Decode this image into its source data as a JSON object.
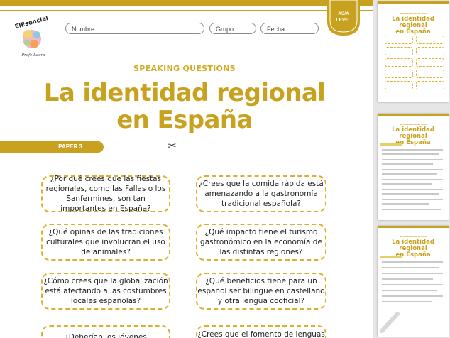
{
  "header": {
    "logo_text": "ElEsencial",
    "logo_sub": "Profe Laura",
    "fields": [
      {
        "label": "Nombre:"
      },
      {
        "label": "Grupo:"
      },
      {
        "label": "Fecha:"
      }
    ],
    "level_badge": {
      "line1": "AS/A",
      "line2": "LEVEL"
    }
  },
  "kicker": "SPEAKING QUESTIONS",
  "title": {
    "line1": "La identidad regional",
    "line2": "en España"
  },
  "paper_label": "PAPER 3",
  "cards": [
    "¿Por qué crees que las fiestas regionales, como las Fallas o los Sanfermines, son tan importantes en España?",
    "¿Crees que la comida rápida está amenazando a la gastronomía tradicional española?",
    "¿Qué opinas de las tradiciones culturales que involucran el uso de animales?",
    "¿Qué impacto tiene el turismo gastronómico en la economía de las distintas regiones?",
    "¿Cómo crees que la globalización está afectando a las costumbres locales españolas?",
    "¿Qué beneficios tiene para un español ser bilingüe en castellano y otra lengua cooficial?",
    "¿Deberían los jóvenes",
    "¿Crees que el fomento de lenguas"
  ],
  "thumbnails": [
    {
      "kicker": "SPEAKING QUESTIONS",
      "title_line1": "La identidad regional",
      "title_line2": "en España"
    },
    {
      "kicker": "SPEAKING QUESTIONS",
      "title_line1": "La identidad regional",
      "title_line2": "en España"
    },
    {
      "kicker": "SPEAKING QUESTIONS",
      "title_line1": "La identidad regional",
      "title_line2": "en España"
    }
  ],
  "colors": {
    "accent": "#c8a21e",
    "card_border": "#d9b12c"
  }
}
